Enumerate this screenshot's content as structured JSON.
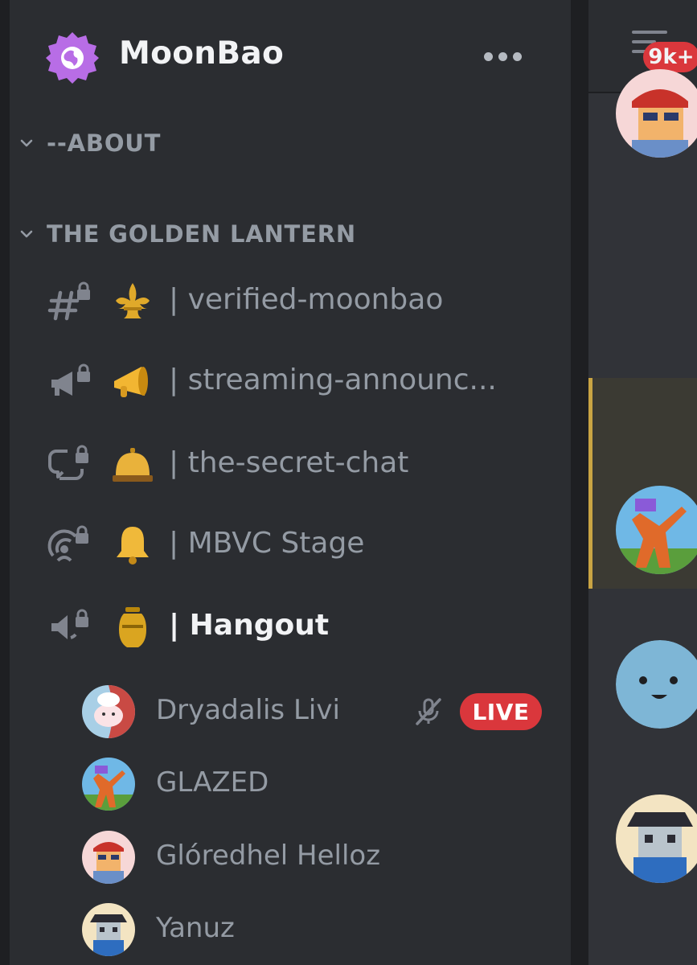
{
  "server": {
    "name": "MoonBao",
    "more_icon": "more-icon"
  },
  "categories": [
    {
      "label": "--ABOUT"
    },
    {
      "label": "THE GOLDEN LANTERN"
    }
  ],
  "channels": [
    {
      "name": "| verified-moonbao",
      "type_icon": "locked-text-channel-icon",
      "emoji": "fleur-de-lis"
    },
    {
      "name": "| streaming-announc...",
      "type_icon": "locked-announcement-icon",
      "emoji": "megaphone"
    },
    {
      "name": "| the-secret-chat",
      "type_icon": "locked-forum-icon",
      "emoji": "service-bell"
    },
    {
      "name": "| MBVC Stage",
      "type_icon": "locked-stage-icon",
      "emoji": "bell"
    },
    {
      "name": "| Hangout",
      "type_icon": "locked-voice-icon",
      "emoji": "urn",
      "active": true
    }
  ],
  "voice_users": [
    {
      "name": "Dryadalis Livi",
      "muted": true,
      "live_label": "LIVE"
    },
    {
      "name": "GLAZED"
    },
    {
      "name": "Glóredhel Helloz"
    },
    {
      "name": "Yanuz"
    }
  ],
  "right_panel": {
    "inbox_badge": "9k+"
  },
  "colors": {
    "sidebar_bg": "#2b2d31",
    "app_bg": "#1e1f22",
    "chat_bg": "#313338",
    "live_red": "#da373c",
    "server_badge": "#b86de6",
    "highlight_gold": "#c9a443"
  }
}
